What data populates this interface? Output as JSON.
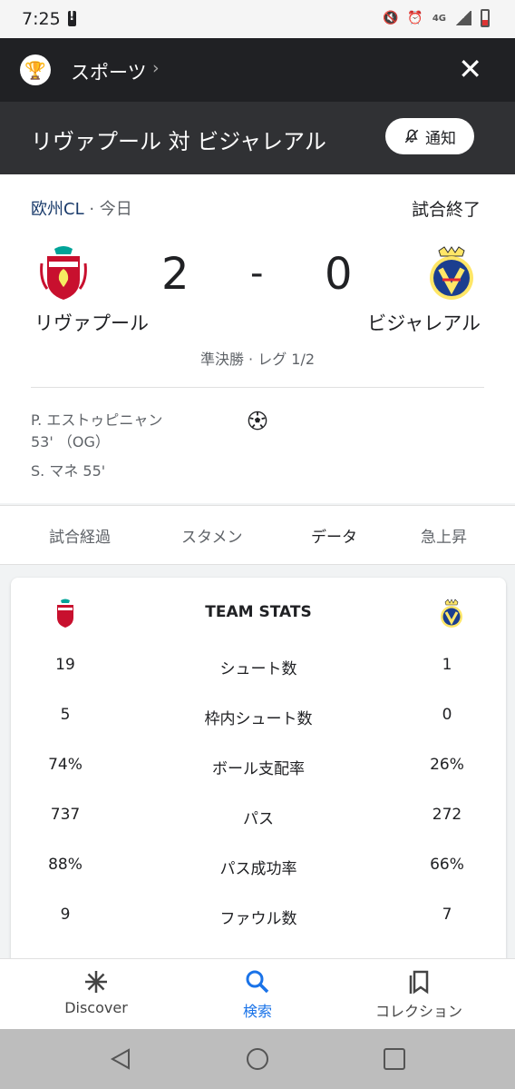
{
  "status_bar": {
    "time": "7:25",
    "network": "4G"
  },
  "top_bar": {
    "section_label": "スポーツ",
    "chevron": "›",
    "close_icon": "✕"
  },
  "title_bar": {
    "title": "リヴァプール 対 ビジャレアル",
    "notify_label": "通知"
  },
  "match": {
    "league": "欧州CL",
    "separator": " · ",
    "date": "今日",
    "status": "試合終了",
    "home_team": "リヴァプール",
    "away_team": "ビジャレアル",
    "home_score": "2",
    "away_score": "0",
    "dash": "-",
    "round": "準決勝 · レグ 1/2",
    "scorers": [
      "P. エストゥピニャン 53' （OG）",
      "S. マネ 55'"
    ]
  },
  "tabs": [
    {
      "label": "試合経過",
      "active": false
    },
    {
      "label": "スタメン",
      "active": false
    },
    {
      "label": "データ",
      "active": true
    },
    {
      "label": "急上昇",
      "active": false
    }
  ],
  "team_stats": {
    "heading": "TEAM STATS",
    "rows": [
      {
        "label": "シュート数",
        "home": "19",
        "away": "1"
      },
      {
        "label": "枠内シュート数",
        "home": "5",
        "away": "0"
      },
      {
        "label": "ボール支配率",
        "home": "74%",
        "away": "26%"
      },
      {
        "label": "パス",
        "home": "737",
        "away": "272"
      },
      {
        "label": "パス成功率",
        "home": "88%",
        "away": "66%"
      },
      {
        "label": "ファウル数",
        "home": "9",
        "away": "7"
      }
    ]
  },
  "bottom_nav": [
    {
      "label": "Discover",
      "icon": "asterisk-icon",
      "active": false
    },
    {
      "label": "検索",
      "icon": "search-icon",
      "active": true
    },
    {
      "label": "コレクション",
      "icon": "bookmarks-icon",
      "active": false
    }
  ],
  "colors": {
    "accent": "#1a73e8",
    "league": "#1a3b6b",
    "lfc_red": "#c8102e",
    "vcf_yellow": "#ffe667"
  }
}
